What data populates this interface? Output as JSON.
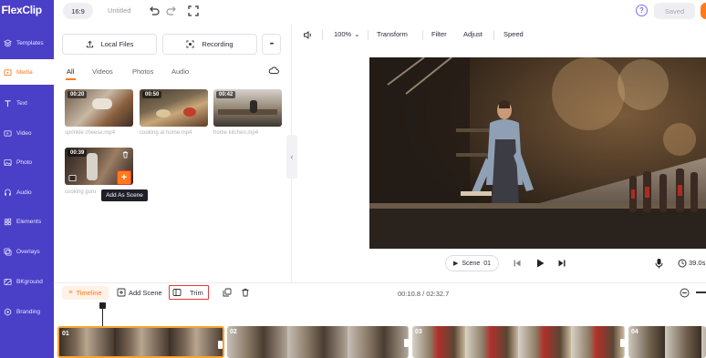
{
  "app": {
    "logo_text": "FlexClip"
  },
  "topbar": {
    "ratio": "16:9",
    "title": "Untitled",
    "saved_label": "Saved"
  },
  "sidebar": {
    "items": [
      {
        "label": "Templates",
        "icon": "templates-icon"
      },
      {
        "label": "Media",
        "icon": "media-icon",
        "active": true
      },
      {
        "label": "Text",
        "icon": "text-icon"
      },
      {
        "label": "Video",
        "icon": "video-icon"
      },
      {
        "label": "Photo",
        "icon": "photo-icon"
      },
      {
        "label": "Audio",
        "icon": "audio-icon"
      },
      {
        "label": "Elements",
        "icon": "elements-icon"
      },
      {
        "label": "Overlays",
        "icon": "overlays-icon"
      },
      {
        "label": "BKground",
        "icon": "background-icon"
      },
      {
        "label": "Branding",
        "icon": "branding-icon"
      }
    ]
  },
  "media": {
    "local_files_label": "Local Files",
    "recording_label": "Recording",
    "more_label": "•••",
    "tabs": [
      "All",
      "Videos",
      "Photos",
      "Audio"
    ],
    "active_tab": "All",
    "items": [
      {
        "duration": "00:20",
        "name": "sprinkle cheese.mp4"
      },
      {
        "duration": "00:50",
        "name": "cooking at home.mp4"
      },
      {
        "duration": "00:42",
        "name": "home kitchen.mp4"
      },
      {
        "duration": "00:39",
        "name": "cooking guru"
      }
    ],
    "add_as_scene_tooltip": "Add As Scene",
    "plus_symbol": "+"
  },
  "preview_toolbar": {
    "zoom": "100%",
    "transform_label": "Transform",
    "filter_label": "Filter",
    "adjust_label": "Adjust",
    "speed_label": "Speed"
  },
  "player": {
    "scene_label": "Scene",
    "scene_number": "01",
    "duration": "39.0s"
  },
  "timeline": {
    "timeline_label": "Timeline",
    "add_scene_label": "Add Scene",
    "trim_label": "Trim",
    "time_code": "00:10.8 / 02:32.7",
    "clips": [
      {
        "number": "01",
        "active": true
      },
      {
        "number": "02"
      },
      {
        "number": "03"
      },
      {
        "number": "04"
      }
    ]
  },
  "colors": {
    "sidebar": "#4a3fc7",
    "accent": "#ff7a1a",
    "highlight_red": "#e63a3a"
  }
}
